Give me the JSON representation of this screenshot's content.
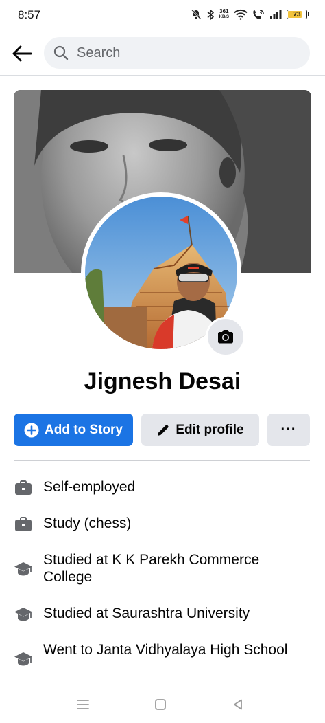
{
  "status_bar": {
    "time": "8:57",
    "net_speed_value": "361",
    "net_speed_unit": "KB/S",
    "battery_level": "73",
    "icons": [
      "mute-icon",
      "bluetooth-icon",
      "wifi-icon",
      "wifi-calling-icon",
      "signal-icon",
      "battery-icon"
    ]
  },
  "search": {
    "placeholder": "Search"
  },
  "profile": {
    "name": "Jignesh Desai"
  },
  "actions": {
    "add_to_story": "Add to Story",
    "edit_profile": "Edit profile",
    "more": "···"
  },
  "details": [
    {
      "icon": "briefcase-icon",
      "text": "Self-employed"
    },
    {
      "icon": "briefcase-icon",
      "text": "Study (chess)"
    },
    {
      "icon": "graduation-cap-icon",
      "text": "Studied at K K Parekh Commerce College"
    },
    {
      "icon": "graduation-cap-icon",
      "text": "Studied at Saurashtra University"
    },
    {
      "icon": "graduation-cap-icon",
      "text": "Went to Janta Vidhyalaya High School"
    }
  ],
  "colors": {
    "accent": "#1b74e4",
    "secondary_button": "#e4e6eb",
    "search_bg": "#f0f2f5",
    "battery": "#f2c33c"
  }
}
